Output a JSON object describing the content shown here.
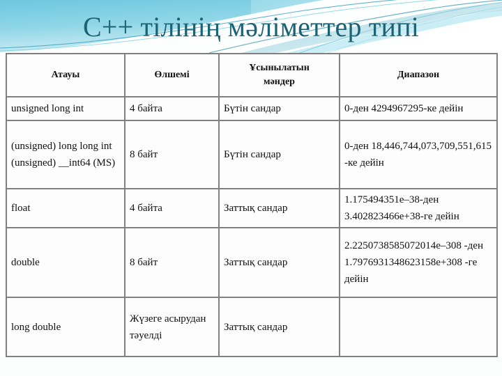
{
  "slide": {
    "title": "C++ тілінің мәліметтер типі",
    "title_color": "#1b6274",
    "background_accent": "#7ccde3",
    "background_base": "#ffffff",
    "table_border_color": "#808080"
  },
  "table": {
    "headers": [
      "Атауы",
      "Өлшемі",
      "Ұсынылатын\nмәндер",
      "Диапазон"
    ],
    "rows": [
      {
        "name": "unsigned long int",
        "size": "4 байта",
        "values": "Бүтін сандар",
        "range": "0-ден 4294967295-ке дейін"
      },
      {
        "name": "(unsigned) long long int\n(unsigned) __int64 (MS)",
        "size": "8 байт",
        "values": "Бүтін сандар",
        "range": "0-ден 18,446,744,073,709,551,615 -ке дейін"
      },
      {
        "name": "float",
        "size": "4 байта",
        "values": "Заттық сандар",
        "range": "1.175494351e–38-ден 3.402823466e+38-ге дейін"
      },
      {
        "name": "double",
        "size": "8 байт",
        "values": "Заттық сандар",
        "range": "2.2250738585072014e–308 -ден 1.7976931348623158e+308 -ге дейін"
      },
      {
        "name": "long double",
        "size": "Жүзеге асырудан тәуелді",
        "values": "Заттық сандар",
        "range": ""
      }
    ]
  }
}
